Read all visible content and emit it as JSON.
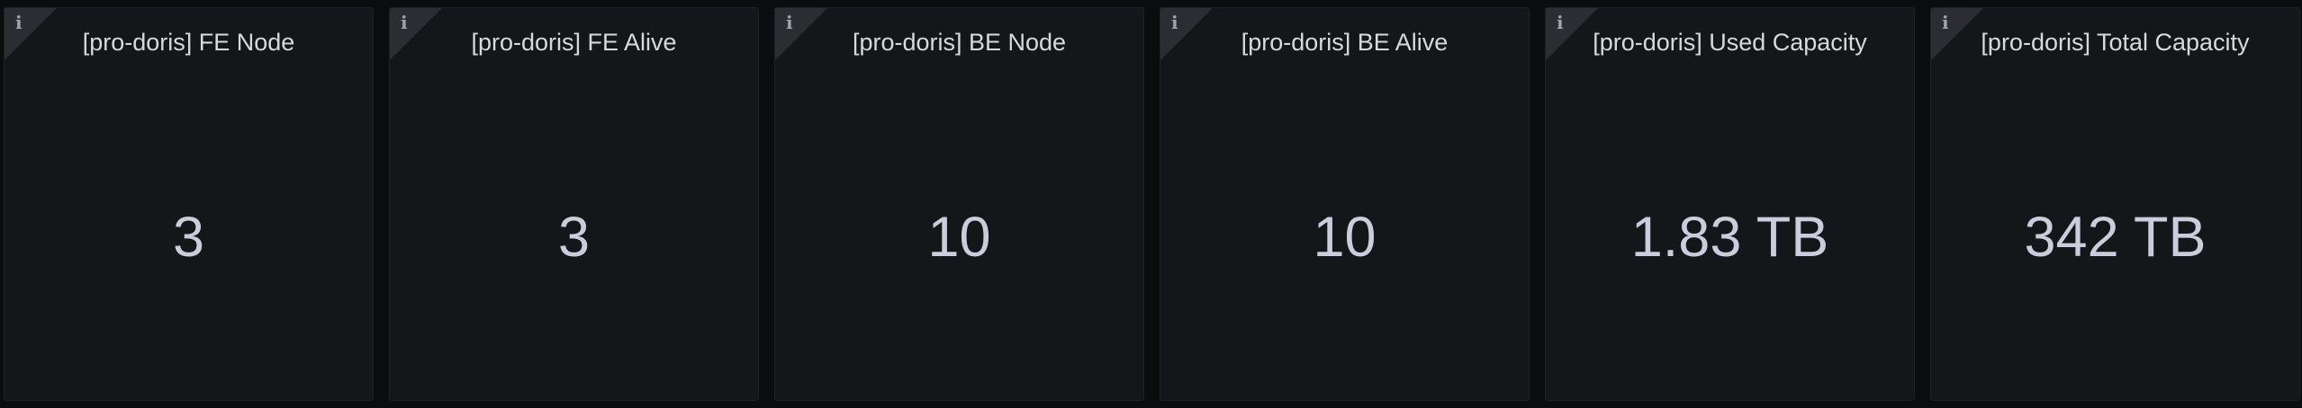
{
  "panels": [
    {
      "title": "[pro-doris] FE Node",
      "value": "3",
      "info_icon": "info-icon"
    },
    {
      "title": "[pro-doris] FE Alive",
      "value": "3",
      "info_icon": "info-icon"
    },
    {
      "title": "[pro-doris] BE Node",
      "value": "10",
      "info_icon": "info-icon"
    },
    {
      "title": "[pro-doris] BE Alive",
      "value": "10",
      "info_icon": "info-icon"
    },
    {
      "title": "[pro-doris] Used Capacity",
      "value": "1.83 TB",
      "info_icon": "info-icon"
    },
    {
      "title": "[pro-doris] Total Capacity",
      "value": "342 TB",
      "info_icon": "info-icon"
    }
  ],
  "info_glyph": "i",
  "colors": {
    "background": "#0b0c0e",
    "panel": "#141619",
    "title": "#d8d9da",
    "value": "#ccccdc",
    "corner": "#2b2d32"
  }
}
